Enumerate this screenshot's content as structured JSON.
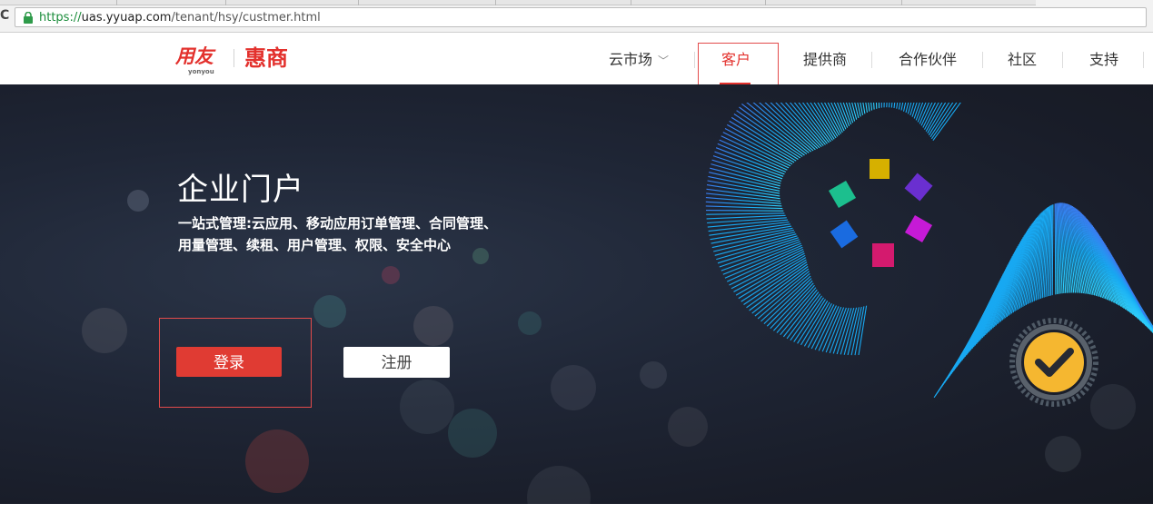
{
  "browser": {
    "url_scheme": "https://",
    "url_host": "uas.yyuap.com",
    "url_path": "/tenant/hsy/custmer.html"
  },
  "header": {
    "logo_cn": "用友",
    "logo_en": "yonyou",
    "brand": "惠商",
    "nav": [
      {
        "label": "云市场"
      },
      {
        "label": "客户"
      },
      {
        "label": "提供商"
      },
      {
        "label": "合作伙伴"
      },
      {
        "label": "社区"
      },
      {
        "label": "支持"
      }
    ],
    "active_nav": "客户"
  },
  "hero": {
    "title": "企业门户",
    "desc_line1": "一站式管理:云应用、移动应用订单管理、合同管理、",
    "desc_line2": "用量管理、续租、用户管理、权限、安全中心",
    "login_label": "登录",
    "register_label": "注册"
  },
  "colors": {
    "brand_red": "#e3312d",
    "login_button": "#e03b33",
    "hero_bg": "#1f2636",
    "annotation": "#e34b4b",
    "spiral_cyan": "#1fb3f5",
    "check_badge": "#f5b730"
  },
  "icons": {
    "reload": "reload-icon",
    "lock": "lock-icon",
    "dropdown": "chevron-down-icon",
    "check": "check-badge-icon"
  }
}
